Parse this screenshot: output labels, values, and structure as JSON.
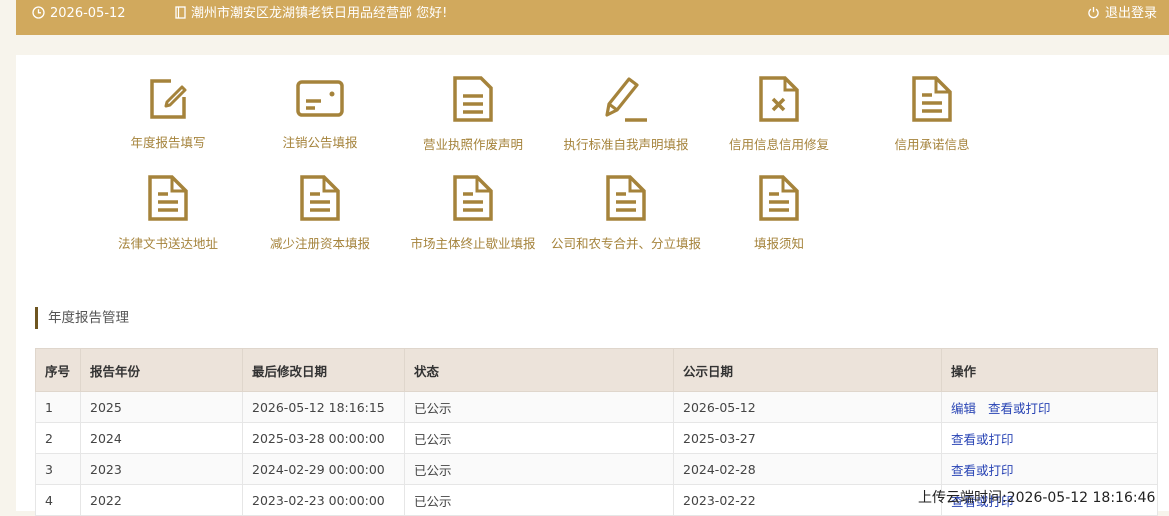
{
  "header": {
    "date": "2026-05-12",
    "greeting": "潮州市潮安区龙湖镇老铁日用品经营部 您好!",
    "logout": "退出登录"
  },
  "menu": [
    {
      "label": "年度报告填写",
      "icon": "edit-icon"
    },
    {
      "label": "注销公告填报",
      "icon": "card-icon"
    },
    {
      "label": "营业执照作废声明",
      "icon": "document-icon"
    },
    {
      "label": "执行标准自我声明填报",
      "icon": "pencil-icon"
    },
    {
      "label": "信用信息信用修复",
      "icon": "document-x-icon"
    },
    {
      "label": "信用承诺信息",
      "icon": "document-icon"
    },
    {
      "label": "法律文书送达地址",
      "icon": "document-icon"
    },
    {
      "label": "减少注册资本填报",
      "icon": "document-icon"
    },
    {
      "label": "市场主体终止歇业填报",
      "icon": "document-icon"
    },
    {
      "label": "公司和农专合并、分立填报",
      "icon": "document-icon"
    },
    {
      "label": "填报须知",
      "icon": "document-icon"
    }
  ],
  "section_title": "年度报告管理",
  "table": {
    "headers": [
      "序号",
      "报告年份",
      "最后修改日期",
      "状态",
      "公示日期",
      "操作"
    ],
    "rows": [
      {
        "no": "1",
        "year": "2025",
        "modified": "2026-05-12 18:16:15",
        "status": "已公示",
        "published": "2026-05-12",
        "ops": [
          "编辑",
          "查看或打印"
        ]
      },
      {
        "no": "2",
        "year": "2024",
        "modified": "2025-03-28 00:00:00",
        "status": "已公示",
        "published": "2025-03-27",
        "ops": [
          "查看或打印"
        ]
      },
      {
        "no": "3",
        "year": "2023",
        "modified": "2024-02-29 00:00:00",
        "status": "已公示",
        "published": "2024-02-28",
        "ops": [
          "查看或打印"
        ]
      },
      {
        "no": "4",
        "year": "2022",
        "modified": "2023-02-23 00:00:00",
        "status": "已公示",
        "published": "2023-02-22",
        "ops": [
          "查看或打印"
        ]
      }
    ]
  },
  "upload_note": "上传云端时间:2026-05-12 18:16:46",
  "colors": {
    "topbar": "#d1a95d",
    "icon": "#a5833b",
    "link": "#2a45b5",
    "table_header": "#ece3da",
    "section_bar": "#6e5520"
  }
}
